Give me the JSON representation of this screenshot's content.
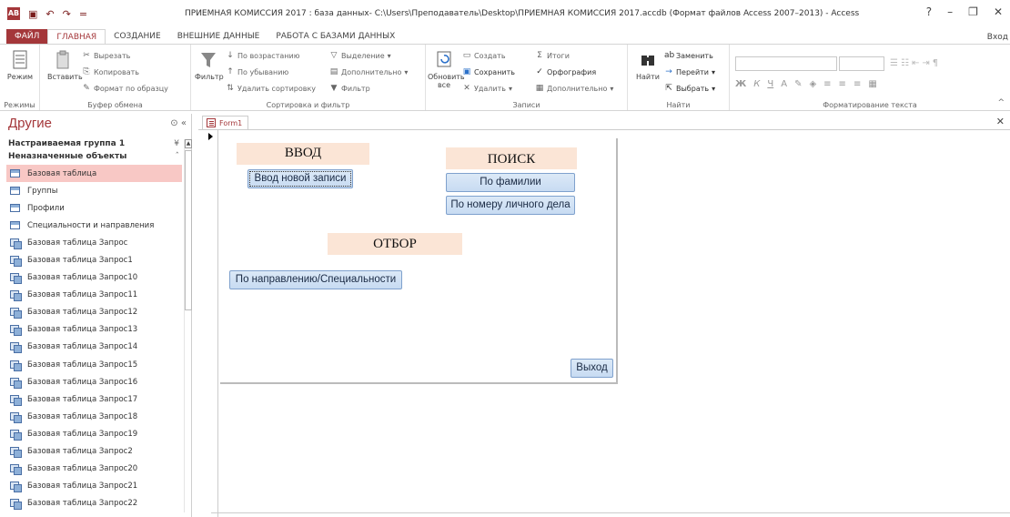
{
  "window": {
    "title": "ПРИЕМНАЯ КОМИССИЯ 2017 : база данных- C:\\Users\\Преподаватель\\Desktop\\ПРИЕМНАЯ КОМИССИЯ 2017.accdb (Формат файлов Access 2007–2013) - Access",
    "app_icon": "AВ",
    "help": "?",
    "minimize": "–",
    "restore": "❐",
    "close": "✕",
    "sign_in": "Вход",
    "qat": {
      "save_icon": "▣",
      "undo_icon": "↶",
      "redo_icon": "↷",
      "more": "="
    }
  },
  "ribbon_tabs": [
    "ФАЙЛ",
    "ГЛАВНАЯ",
    "СОЗДАНИЕ",
    "ВНЕШНИЕ ДАННЫЕ",
    "РАБОТА С БАЗАМИ ДАННЫХ"
  ],
  "ribbon": {
    "views": {
      "label": "Режимы",
      "mode": "Режим"
    },
    "clipboard": {
      "label": "Буфер обмена",
      "paste": "Вставить",
      "cut": "Вырезать",
      "copy": "Копировать",
      "format_painter": "Формат по образцу"
    },
    "sort_filter": {
      "label": "Сортировка и фильтр",
      "filter": "Фильтр",
      "ascending": "По возрастанию",
      "descending": "По убыванию",
      "remove_sort": "Удалить сортировку",
      "selection": "Выделение",
      "advanced": "Дополнительно",
      "toggle_filter": "Фильтр"
    },
    "records": {
      "label": "Записи",
      "refresh": "Обновить",
      "refresh2": "все",
      "new": "Создать",
      "save": "Сохранить",
      "delete": "Удалить",
      "totals": "Итоги",
      "spelling": "Орфография",
      "more": "Дополнительно"
    },
    "find": {
      "label": "Найти",
      "find": "Найти",
      "replace": "Заменить",
      "goto": "Перейти",
      "select": "Выбрать"
    },
    "text_format": {
      "label": "Форматирование текста",
      "bold": "Ж",
      "italic": "К",
      "underline": "Ч"
    }
  },
  "nav": {
    "title": "Другие",
    "group1": "Настраиваемая группа 1",
    "group2": "Неназначенные объекты",
    "items": [
      "Базовая таблица",
      "Группы",
      "Профили",
      "Специальности и направления",
      "Базовая таблица Запрос",
      "Базовая таблица Запрос1",
      "Базовая таблица Запрос10",
      "Базовая таблица Запрос11",
      "Базовая таблица Запрос12",
      "Базовая таблица Запрос13",
      "Базовая таблица Запрос14",
      "Базовая таблица Запрос15",
      "Базовая таблица Запрос16",
      "Базовая таблица Запрос17",
      "Базовая таблица Запрос18",
      "Базовая таблица Запрос19",
      "Базовая таблица Запрос2",
      "Базовая таблица Запрос20",
      "Базовая таблица Запрос21",
      "Базовая таблица Запрос22"
    ],
    "selected_index": 0
  },
  "document": {
    "tab": "Form1",
    "labels": {
      "input": "ВВОД",
      "search": "ПОИСК",
      "select": "ОТБОР"
    },
    "buttons": {
      "new_record": "Ввод новой записи",
      "by_surname": "По фамилии",
      "by_file_number": "По номеру личного дела",
      "by_specialty": "По направлению/Специальности",
      "exit": "Выход"
    }
  },
  "colors": {
    "accent": "#a4373a",
    "label_bg": "#fbe5d6",
    "button_bg": "#c7dbf2",
    "selected_nav": "#f8c8c5"
  }
}
